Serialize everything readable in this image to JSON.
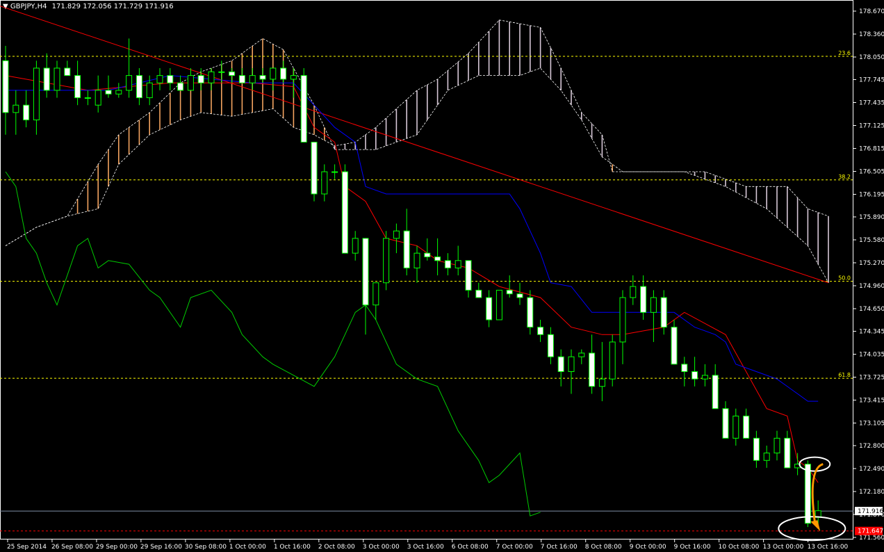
{
  "header": {
    "symbol": "GBPJPY,H4",
    "ohlc": "171.829 172.056 171.729 171.916"
  },
  "colors": {
    "background": "#000000",
    "candle_up": "#000000",
    "candle_down": "#ffffff",
    "candle_wick": "#00ff00",
    "tenkan": "#ff0000",
    "kijun": "#0000ff",
    "chikou": "#00cc00",
    "cloud_bull": "#f4a460",
    "cloud_bear": "#d8c8d8",
    "fib": "#ffff00",
    "trendline": "#ff0000",
    "annotation_circle": "#ffffff",
    "annotation_arrow": "#ff9900"
  },
  "chart_data": {
    "type": "candlestick",
    "yaxis": {
      "ylim": [
        171.56,
        178.67
      ],
      "ticks": [
        "178.670",
        "178.360",
        "178.050",
        "177.745",
        "177.435",
        "177.125",
        "176.815",
        "176.505",
        "176.195",
        "175.890",
        "175.580",
        "175.270",
        "174.960",
        "174.650",
        "174.345",
        "174.035",
        "173.725",
        "173.415",
        "173.105",
        "172.800",
        "172.490",
        "172.180",
        "171.870",
        "171.560"
      ]
    },
    "xaxis": {
      "labels": [
        "25 Sep 2014",
        "26 Sep 08:00",
        "29 Sep 00:00",
        "29 Sep 16:00",
        "30 Sep 08:00",
        "1 Oct 00:00",
        "1 Oct 16:00",
        "2 Oct 08:00",
        "3 Oct 00:00",
        "3 Oct 16:00",
        "6 Oct 08:00",
        "7 Oct 00:00",
        "7 Oct 16:00",
        "8 Oct 08:00",
        "9 Oct 00:00",
        "9 Oct 16:00",
        "10 Oct 08:00",
        "13 Oct 00:00",
        "13 Oct 16:00"
      ]
    },
    "price_labels": {
      "current": "171.916",
      "marked": "171.647"
    },
    "fib_levels": [
      {
        "label": "23.6",
        "price": 178.06
      },
      {
        "label": "38.2",
        "price": 176.39
      },
      {
        "label": "50.0",
        "price": 175.02
      },
      {
        "label": "61.8",
        "price": 173.71
      }
    ],
    "candles": [
      [
        178.0,
        178.2,
        177.0,
        177.3
      ],
      [
        177.3,
        177.6,
        177.0,
        177.4
      ],
      [
        177.4,
        177.6,
        177.1,
        177.2
      ],
      [
        177.2,
        178.0,
        177.0,
        177.9
      ],
      [
        177.9,
        178.1,
        177.5,
        177.6
      ],
      [
        177.6,
        178.0,
        177.5,
        177.9
      ],
      [
        177.9,
        178.0,
        177.8,
        177.8
      ],
      [
        177.8,
        178.0,
        177.4,
        177.5
      ],
      [
        177.5,
        177.6,
        177.4,
        177.5
      ],
      [
        177.4,
        177.8,
        177.3,
        177.6
      ],
      [
        177.6,
        177.8,
        177.5,
        177.55
      ],
      [
        177.55,
        177.7,
        177.5,
        177.6
      ],
      [
        177.6,
        178.3,
        177.5,
        177.8
      ],
      [
        177.8,
        177.9,
        177.4,
        177.5
      ],
      [
        177.5,
        177.8,
        177.4,
        177.7
      ],
      [
        177.7,
        177.9,
        177.6,
        177.8
      ],
      [
        177.8,
        177.9,
        177.6,
        177.7
      ],
      [
        177.7,
        177.8,
        177.6,
        177.6
      ],
      [
        177.6,
        177.9,
        177.6,
        177.8
      ],
      [
        177.8,
        177.9,
        177.6,
        177.7
      ],
      [
        177.7,
        177.9,
        177.6,
        177.85
      ],
      [
        177.85,
        178.0,
        177.7,
        177.85
      ],
      [
        177.85,
        177.9,
        177.7,
        177.8
      ],
      [
        177.8,
        177.9,
        177.7,
        177.7
      ],
      [
        177.7,
        177.9,
        177.6,
        177.8
      ],
      [
        177.8,
        177.9,
        177.7,
        177.75
      ],
      [
        177.75,
        177.9,
        177.6,
        177.9
      ],
      [
        177.9,
        178.0,
        177.7,
        177.75
      ],
      [
        177.75,
        177.9,
        177.5,
        177.8
      ],
      [
        177.8,
        177.9,
        176.9,
        176.9
      ],
      [
        176.9,
        176.9,
        176.1,
        176.2
      ],
      [
        176.2,
        176.6,
        176.1,
        176.5
      ],
      [
        176.5,
        176.6,
        176.4,
        176.5
      ],
      [
        176.5,
        176.6,
        175.4,
        175.4
      ],
      [
        175.4,
        175.7,
        175.3,
        175.6
      ],
      [
        175.6,
        175.6,
        174.3,
        174.7
      ],
      [
        174.7,
        175.0,
        174.5,
        175.0
      ],
      [
        175.0,
        175.7,
        174.9,
        175.6
      ],
      [
        175.6,
        175.8,
        175.4,
        175.7
      ],
      [
        175.7,
        176.0,
        175.1,
        175.2
      ],
      [
        175.2,
        175.5,
        175.0,
        175.4
      ],
      [
        175.4,
        175.6,
        175.3,
        175.35
      ],
      [
        175.35,
        175.6,
        175.1,
        175.3
      ],
      [
        175.3,
        175.4,
        175.1,
        175.2
      ],
      [
        175.2,
        175.5,
        175.1,
        175.3
      ],
      [
        175.3,
        175.3,
        174.8,
        174.9
      ],
      [
        174.9,
        175.0,
        174.8,
        174.8
      ],
      [
        174.8,
        174.9,
        174.4,
        174.5
      ],
      [
        174.5,
        174.9,
        174.5,
        174.9
      ],
      [
        174.9,
        175.1,
        174.8,
        174.85
      ],
      [
        174.85,
        175.0,
        174.7,
        174.8
      ],
      [
        174.8,
        174.9,
        174.3,
        174.4
      ],
      [
        174.4,
        174.5,
        174.2,
        174.3
      ],
      [
        174.3,
        174.4,
        173.9,
        174.0
      ],
      [
        174.0,
        174.1,
        173.6,
        173.8
      ],
      [
        173.8,
        174.1,
        173.5,
        174.0
      ],
      [
        174.0,
        174.1,
        173.9,
        174.05
      ],
      [
        174.05,
        174.3,
        173.5,
        173.6
      ],
      [
        173.6,
        174.2,
        173.4,
        173.7
      ],
      [
        173.7,
        174.3,
        173.6,
        174.2
      ],
      [
        174.2,
        174.9,
        173.9,
        174.8
      ],
      [
        174.8,
        175.1,
        174.7,
        174.95
      ],
      [
        174.95,
        175.1,
        174.5,
        174.6
      ],
      [
        174.6,
        174.9,
        174.2,
        174.8
      ],
      [
        174.8,
        174.9,
        174.3,
        174.4
      ],
      [
        174.4,
        174.5,
        173.9,
        173.9
      ],
      [
        173.9,
        174.0,
        173.6,
        173.8
      ],
      [
        173.8,
        174.0,
        173.6,
        173.7
      ],
      [
        173.7,
        173.9,
        173.6,
        173.75
      ],
      [
        173.75,
        173.9,
        173.3,
        173.3
      ],
      [
        173.3,
        173.4,
        172.9,
        172.9
      ],
      [
        172.9,
        173.3,
        172.8,
        173.2
      ],
      [
        173.2,
        173.3,
        172.9,
        172.9
      ],
      [
        172.9,
        173.0,
        172.5,
        172.6
      ],
      [
        172.6,
        172.8,
        172.5,
        172.7
      ],
      [
        172.7,
        173.0,
        172.6,
        172.9
      ],
      [
        172.9,
        173.0,
        172.5,
        172.5
      ],
      [
        172.5,
        172.7,
        172.4,
        172.55
      ],
      [
        172.55,
        172.6,
        171.7,
        171.75
      ],
      [
        171.83,
        172.06,
        171.73,
        171.92
      ]
    ],
    "series": [
      {
        "role": "tenkan",
        "points": [
          [
            0,
            177.8
          ],
          [
            8,
            177.6
          ],
          [
            16,
            177.7
          ],
          [
            24,
            177.7
          ],
          [
            28,
            177.65
          ],
          [
            30,
            177.1
          ],
          [
            32,
            176.9
          ],
          [
            33,
            176.3
          ],
          [
            35,
            176.1
          ],
          [
            37,
            175.6
          ],
          [
            40,
            175.5
          ],
          [
            42,
            175.3
          ],
          [
            45,
            175.2
          ],
          [
            48,
            174.95
          ],
          [
            52,
            174.8
          ],
          [
            55,
            174.4
          ],
          [
            58,
            174.3
          ],
          [
            60,
            174.3
          ],
          [
            64,
            174.4
          ],
          [
            66,
            174.6
          ],
          [
            70,
            174.3
          ],
          [
            72,
            173.8
          ],
          [
            74,
            173.3
          ],
          [
            76,
            173.2
          ],
          [
            77,
            172.6
          ],
          [
            78,
            172.5
          ],
          [
            79,
            172.3
          ]
        ]
      },
      {
        "role": "kijun",
        "points": [
          [
            0,
            177.6
          ],
          [
            10,
            177.6
          ],
          [
            16,
            177.8
          ],
          [
            24,
            177.7
          ],
          [
            28,
            177.7
          ],
          [
            30,
            177.4
          ],
          [
            32,
            177.1
          ],
          [
            34,
            176.9
          ],
          [
            35,
            176.3
          ],
          [
            37,
            176.2
          ],
          [
            49,
            176.2
          ],
          [
            50,
            176.0
          ],
          [
            52,
            175.4
          ],
          [
            53,
            175.0
          ],
          [
            55,
            174.95
          ],
          [
            57,
            174.6
          ],
          [
            60,
            174.6
          ],
          [
            65,
            174.6
          ],
          [
            67,
            174.4
          ],
          [
            69,
            174.3
          ],
          [
            70,
            174.2
          ],
          [
            71,
            173.9
          ],
          [
            73,
            173.8
          ],
          [
            75,
            173.7
          ],
          [
            77,
            173.5
          ],
          [
            78,
            173.4
          ],
          [
            79,
            173.4
          ]
        ]
      },
      {
        "role": "chikou",
        "points": [
          [
            0,
            176.5
          ],
          [
            1,
            176.3
          ],
          [
            2,
            175.6
          ],
          [
            3,
            175.4
          ],
          [
            4,
            175.0
          ],
          [
            5,
            174.7
          ],
          [
            7,
            175.5
          ],
          [
            8,
            175.6
          ],
          [
            9,
            175.2
          ],
          [
            10,
            175.3
          ],
          [
            12,
            175.25
          ],
          [
            14,
            174.9
          ],
          [
            15,
            174.8
          ],
          [
            17,
            174.4
          ],
          [
            18,
            174.8
          ],
          [
            20,
            174.9
          ],
          [
            22,
            174.6
          ],
          [
            23,
            174.3
          ],
          [
            25,
            174.0
          ],
          [
            26,
            173.9
          ],
          [
            28,
            173.75
          ],
          [
            30,
            173.6
          ],
          [
            32,
            174.0
          ],
          [
            34,
            174.6
          ],
          [
            35,
            174.7
          ],
          [
            36,
            174.5
          ],
          [
            38,
            173.9
          ],
          [
            40,
            173.7
          ],
          [
            42,
            173.6
          ],
          [
            44,
            173.0
          ],
          [
            46,
            172.6
          ],
          [
            47,
            172.3
          ],
          [
            48,
            172.4
          ],
          [
            50,
            172.7
          ],
          [
            51,
            171.85
          ],
          [
            52,
            171.9
          ]
        ]
      },
      {
        "role": "senkou_a",
        "points": [
          [
            0,
            175.5
          ],
          [
            3,
            175.75
          ],
          [
            6,
            175.9
          ],
          [
            9,
            176.6
          ],
          [
            11,
            177.0
          ],
          [
            14,
            177.3
          ],
          [
            17,
            177.7
          ],
          [
            19,
            177.85
          ],
          [
            22,
            178.0
          ],
          [
            25,
            178.3
          ],
          [
            27,
            178.15
          ],
          [
            28,
            177.9
          ],
          [
            30,
            177.4
          ],
          [
            32,
            176.8
          ],
          [
            36,
            176.8
          ],
          [
            40,
            177.0
          ],
          [
            43,
            177.6
          ],
          [
            46,
            177.8
          ],
          [
            50,
            177.8
          ],
          [
            52,
            177.9
          ],
          [
            54,
            177.6
          ],
          [
            56,
            177.2
          ],
          [
            58,
            176.7
          ],
          [
            60,
            176.5
          ],
          [
            66,
            176.5
          ],
          [
            70,
            176.3
          ],
          [
            74,
            176.0
          ],
          [
            78,
            175.5
          ],
          [
            80,
            175.0
          ]
        ]
      },
      {
        "role": "senkou_b",
        "points": [
          [
            0,
            175.5
          ],
          [
            3,
            175.75
          ],
          [
            6,
            175.9
          ],
          [
            9,
            176.0
          ],
          [
            11,
            176.6
          ],
          [
            14,
            177.0
          ],
          [
            17,
            177.2
          ],
          [
            19,
            177.3
          ],
          [
            22,
            177.25
          ],
          [
            24,
            177.3
          ],
          [
            26,
            177.35
          ],
          [
            28,
            177.1
          ],
          [
            30,
            177.0
          ],
          [
            32,
            176.85
          ],
          [
            34,
            176.9
          ],
          [
            36,
            177.1
          ],
          [
            38,
            177.35
          ],
          [
            40,
            177.6
          ],
          [
            42,
            177.75
          ],
          [
            45,
            178.1
          ],
          [
            48,
            178.55
          ],
          [
            50,
            178.5
          ],
          [
            52,
            178.45
          ],
          [
            54,
            177.9
          ],
          [
            56,
            177.3
          ],
          [
            58,
            177.0
          ],
          [
            59,
            176.5
          ],
          [
            63,
            176.5
          ],
          [
            68,
            176.5
          ],
          [
            72,
            176.3
          ],
          [
            76,
            176.3
          ],
          [
            78,
            176.0
          ],
          [
            80,
            175.9
          ]
        ]
      }
    ],
    "trendline": {
      "from": [
        -4,
        178.9
      ],
      "to": [
        80,
        175.0
      ]
    },
    "annotations": {
      "ellipse_top": {
        "x": 78.4,
        "y": 172.55
      },
      "ellipse_bottom": {
        "x": 78.4,
        "y": 171.68
      }
    }
  }
}
